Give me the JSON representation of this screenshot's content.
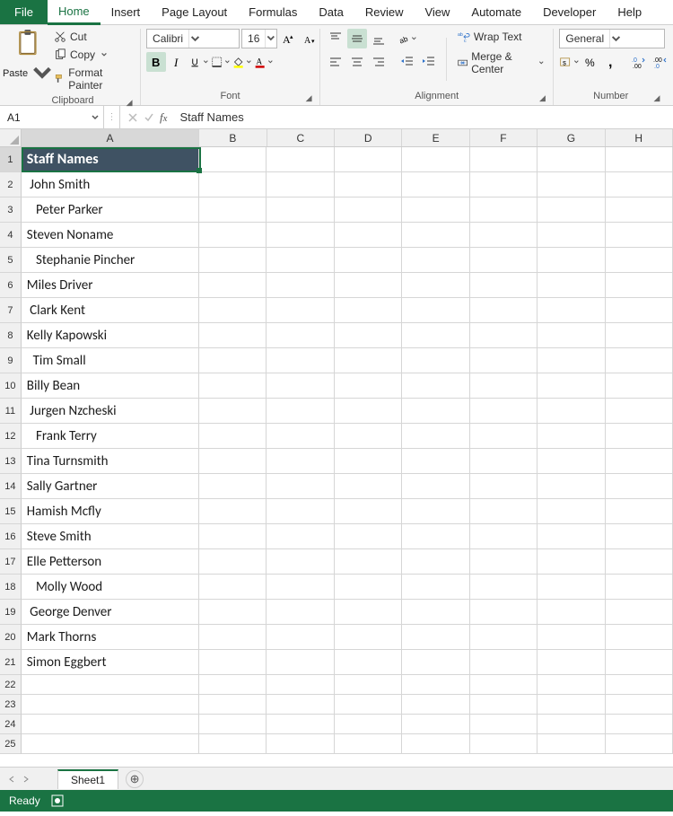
{
  "tabs": [
    "File",
    "Home",
    "Insert",
    "Page Layout",
    "Formulas",
    "Data",
    "Review",
    "View",
    "Automate",
    "Developer",
    "Help"
  ],
  "active_tab": "Home",
  "clipboard": {
    "paste": "Paste",
    "cut": "Cut",
    "copy": "Copy",
    "format_painter": "Format Painter",
    "group": "Clipboard"
  },
  "font": {
    "name": "Calibri",
    "size": "16",
    "group": "Font"
  },
  "alignment": {
    "wrap": "Wrap Text",
    "merge": "Merge & Center",
    "group": "Alignment"
  },
  "number": {
    "format": "General",
    "group": "Number"
  },
  "namebox": "A1",
  "formula": "Staff Names",
  "columns": [
    "A",
    "B",
    "C",
    "D",
    "E",
    "F",
    "G",
    "H"
  ],
  "cells": {
    "header": "Staff Names",
    "rows": [
      " John Smith",
      "   Peter Parker",
      "Steven Noname",
      "   Stephanie Pincher",
      "Miles Driver",
      " Clark Kent",
      "Kelly Kapowski",
      "  Tim Small",
      "Billy Bean",
      " Jurgen Nzcheski",
      "   Frank Terry",
      "Tina Turnsmith",
      "Sally Gartner",
      "Hamish Mcfly",
      "Steve Smith",
      "Elle Petterson",
      "   Molly Wood",
      " George Denver",
      "Mark Thorns",
      "Simon Eggbert"
    ]
  },
  "total_rows": 25,
  "sheet": "Sheet1",
  "status": "Ready"
}
